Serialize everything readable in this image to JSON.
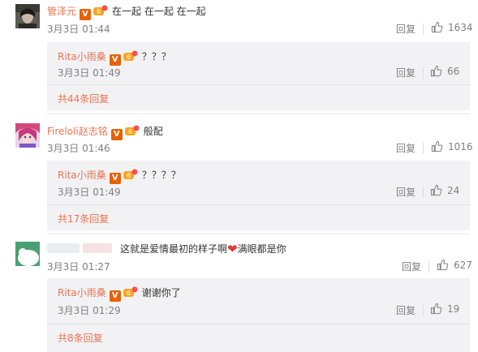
{
  "comments": [
    {
      "user": "管泽元",
      "verified": "V",
      "text": "在一起 在一起 在一起",
      "time": "3月3日 01:44",
      "reply": "回复",
      "likes": "1634",
      "sub": {
        "user": "Rita小雨桑",
        "verified": "V",
        "text": "？？？",
        "time": "3月3日 01:49",
        "reply": "回复",
        "likes": "66",
        "more": "共44条回复"
      }
    },
    {
      "user": "Fireloli赵志铭",
      "verified": "V",
      "text": "般配",
      "time": "3月3日 01:46",
      "reply": "回复",
      "likes": "1016",
      "sub": {
        "user": "Rita小雨桑",
        "verified": "V",
        "text": "？？？？",
        "time": "3月3日 01:49",
        "reply": "回复",
        "likes": "24",
        "more": "共17条回复"
      }
    },
    {
      "user": "",
      "verified": "",
      "text_before": "这就是爱情最初的样子啊",
      "text_after": "满眼都是你",
      "time": "3月3日 01:27",
      "reply": "回复",
      "likes": "627",
      "sub": {
        "user": "Rita小雨桑",
        "verified": "V",
        "text": "谢谢你了",
        "time": "3月3日 01:29",
        "reply": "回复",
        "likes": "19",
        "more": "共8条回复"
      }
    }
  ],
  "colors": {
    "username": "#eb7350",
    "meta": "#808080",
    "subbg": "#f2f2f5",
    "badge": "#e66100"
  },
  "icons": {
    "like": "thumbs-up-icon",
    "heart": "heart-icon",
    "level": "member-level-icon"
  }
}
